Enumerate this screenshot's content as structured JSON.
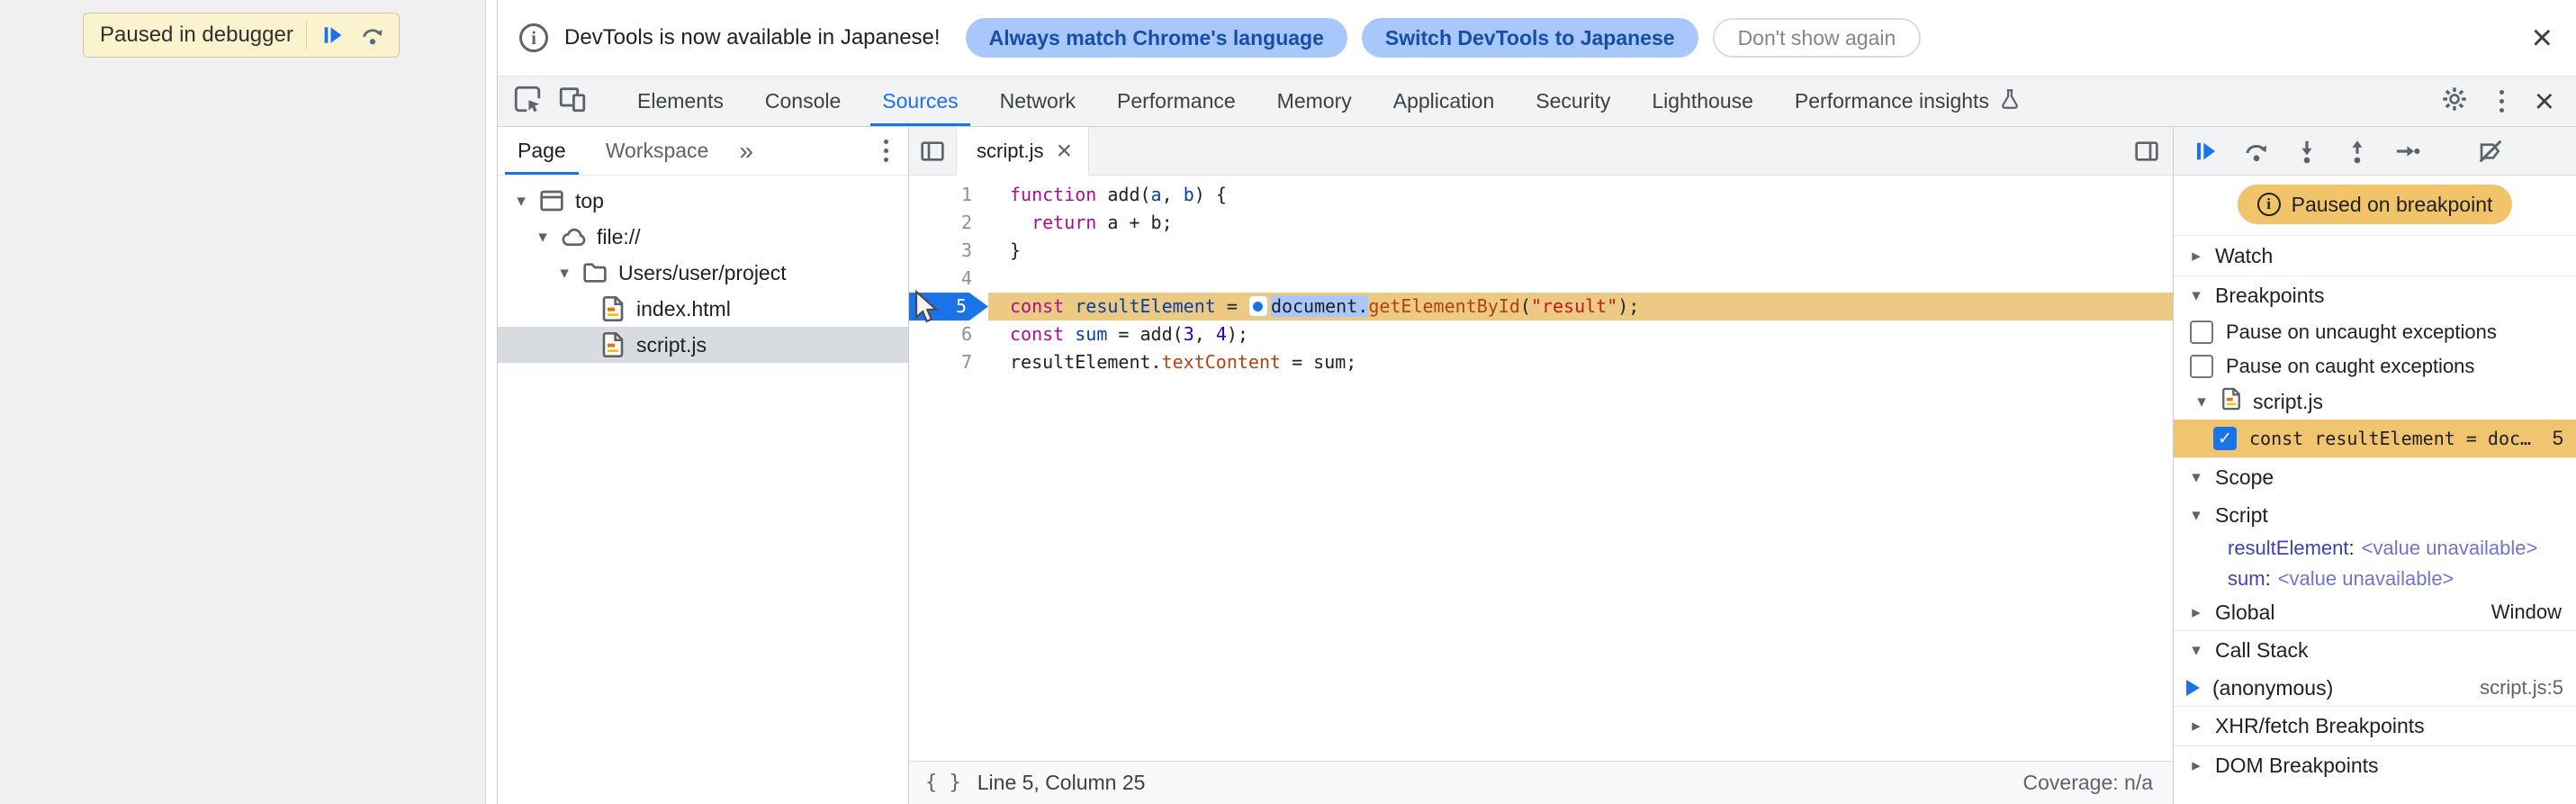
{
  "page": {
    "banner": {
      "label": "Paused in debugger"
    }
  },
  "infobar": {
    "message": "DevTools is now available in Japanese!",
    "primary_button": "Always match Chrome's language",
    "secondary_button": "Switch DevTools to Japanese",
    "dismiss_button": "Don't show again",
    "close": "×"
  },
  "toolbar": {
    "tabs": [
      {
        "label": "Elements"
      },
      {
        "label": "Console"
      },
      {
        "label": "Sources"
      },
      {
        "label": "Network"
      },
      {
        "label": "Performance"
      },
      {
        "label": "Memory"
      },
      {
        "label": "Application"
      },
      {
        "label": "Security"
      },
      {
        "label": "Lighthouse"
      },
      {
        "label": "Performance insights"
      }
    ],
    "active_tab": "Sources",
    "close": "×"
  },
  "navigator": {
    "tabs": {
      "page": "Page",
      "workspace": "Workspace",
      "overflow": "»"
    },
    "tree": [
      {
        "label": "top"
      },
      {
        "label": "file://"
      },
      {
        "label": "Users/user/project"
      },
      {
        "label": "index.html"
      },
      {
        "label": "script.js"
      }
    ]
  },
  "editor": {
    "tab": {
      "label": "script.js",
      "close": "×"
    },
    "lines": [
      {
        "num": "1",
        "tokens": [
          "function",
          " add(",
          "a",
          ", ",
          "b",
          ") {"
        ]
      },
      {
        "num": "2",
        "tokens": [
          "  ",
          "return",
          " a + b;"
        ]
      },
      {
        "num": "3",
        "tokens": [
          "}"
        ]
      },
      {
        "num": "4",
        "tokens": []
      },
      {
        "num": "5",
        "tokens": [
          "const",
          " ",
          "resultElement",
          " = ",
          "document.",
          "getElementById",
          "(",
          "\"result\"",
          ");"
        ]
      },
      {
        "num": "6",
        "tokens": [
          "const",
          " ",
          "sum",
          " = add(",
          "3",
          ", ",
          "4",
          ");"
        ]
      },
      {
        "num": "7",
        "tokens": [
          "resultElement.",
          "textContent",
          " = sum;"
        ]
      }
    ],
    "status": {
      "position": "Line 5, Column 25",
      "coverage": "Coverage: n/a",
      "pretty_print": "{ }"
    }
  },
  "debugger": {
    "paused_badge": "Paused on breakpoint",
    "watch": {
      "title": "Watch"
    },
    "breakpoints": {
      "title": "Breakpoints",
      "pause_uncaught": "Pause on uncaught exceptions",
      "pause_caught": "Pause on caught exceptions",
      "file": "script.js",
      "entry": {
        "code": "const resultElement = doc…",
        "line": "5"
      }
    },
    "scope": {
      "title": "Scope",
      "script_section": "Script",
      "vars": [
        {
          "name": "resultElement",
          "value": "<value unavailable>"
        },
        {
          "name": "sum",
          "value": "<value unavailable>"
        }
      ],
      "global_section": "Global",
      "global_value": "Window"
    },
    "call_stack": {
      "title": "Call Stack",
      "frames": [
        {
          "name": "(anonymous)",
          "location": "script.js:5"
        }
      ]
    },
    "xhr": {
      "title": "XHR/fetch Breakpoints"
    },
    "dom": {
      "title": "DOM Breakpoints"
    }
  },
  "icons": {
    "info": "circle-i",
    "close": "×",
    "settings": "gear",
    "more": "kebab-menu",
    "inspect": "cursor-in-box",
    "device_toolbar": "phone-and-tablet",
    "experiment": "flask",
    "frame": "browser-frame",
    "origin": "cloud",
    "folder": "folder",
    "file": "document-page",
    "resume": "play-with-bar",
    "step_over": "arc-arrow-over-dot",
    "step_into": "arrow-down-to-dot",
    "step_out": "arrow-up-from-dot",
    "step": "arrow-into-dot",
    "deactivate_breakpoints": "breakpoint-slash"
  },
  "colors": {
    "accent_blue": "#1a73e8",
    "infobar_button_bg": "#a8c7fa",
    "infobar_button_text": "#174ea6",
    "paused_badge_bg": "#f2c46a",
    "breakpoint_row_bg": "#f1c470",
    "exec_line_bg": "#edca84",
    "token_keyword": "#aa0d91",
    "token_definition": "#0842a0",
    "token_property": "#b3430e",
    "token_string": "#c41a16",
    "token_number": "#1c00cf",
    "selection_bg": "#a9c7fb"
  }
}
